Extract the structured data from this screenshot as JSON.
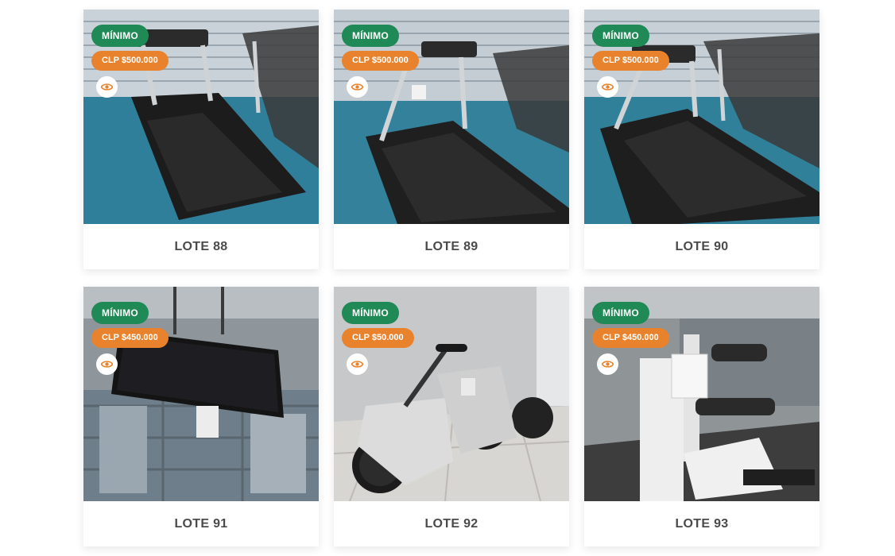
{
  "colors": {
    "min_badge": "#1f8a55",
    "price_badge": "#e9822c",
    "caption_text": "#4a4a4a"
  },
  "lots": [
    {
      "min_label": "MÍNIMO",
      "price": "CLP $500.000",
      "title": "LOTE 88",
      "scene": "treadmill",
      "view_icon": "eye-icon"
    },
    {
      "min_label": "MÍNIMO",
      "price": "CLP $500.000",
      "title": "LOTE 89",
      "scene": "treadmill",
      "view_icon": "eye-icon"
    },
    {
      "min_label": "MÍNIMO",
      "price": "CLP $500.000",
      "title": "LOTE 90",
      "scene": "treadmill",
      "view_icon": "eye-icon"
    },
    {
      "min_label": "MÍNIMO",
      "price": "CLP $450.000",
      "title": "LOTE 91",
      "scene": "tv",
      "view_icon": "eye-icon"
    },
    {
      "min_label": "MÍNIMO",
      "price": "CLP $50.000",
      "title": "LOTE 92",
      "scene": "bikes",
      "view_icon": "eye-icon"
    },
    {
      "min_label": "MÍNIMO",
      "price": "CLP $450.000",
      "title": "LOTE 93",
      "scene": "machine",
      "view_icon": "eye-icon"
    }
  ]
}
